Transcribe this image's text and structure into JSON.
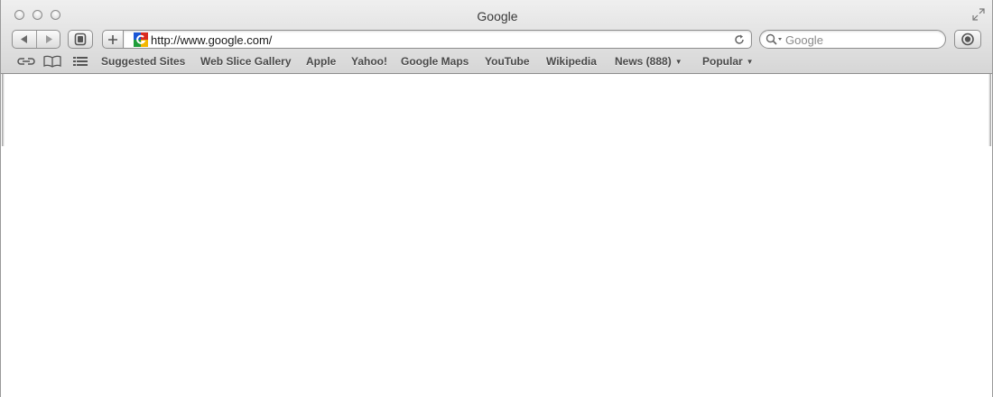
{
  "window": {
    "title": "Google"
  },
  "toolbar": {
    "url": "http://www.google.com/",
    "search_placeholder": "Google"
  },
  "bookmarks": {
    "items": [
      {
        "label": "Suggested Sites"
      },
      {
        "label": "Web Slice Gallery"
      },
      {
        "label": "Apple"
      },
      {
        "label": "Yahoo!"
      },
      {
        "label": "Google Maps"
      },
      {
        "label": "YouTube"
      },
      {
        "label": "Wikipedia"
      },
      {
        "label": "News (888)",
        "has_menu": true
      },
      {
        "label": "Popular",
        "has_menu": true
      }
    ],
    "menu_arrow": "▼"
  },
  "icons": {
    "reading_list": "reading-list-icon",
    "bookmarks": "book-icon",
    "top_sites": "top-sites-grid-icon",
    "favicon": "google-favicon",
    "reload": "reload-icon",
    "search": "search-icon",
    "action": "action-icon"
  },
  "colors": {
    "toolbar_top": "#efefef",
    "toolbar_bottom": "#d6d6d6",
    "bookmark_text": "#4a4a4a"
  }
}
